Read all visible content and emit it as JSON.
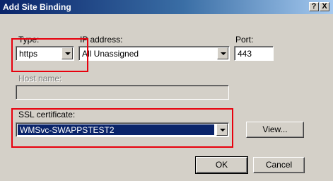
{
  "window": {
    "title": "Add Site Binding",
    "help_label": "?",
    "close_label": "X"
  },
  "type": {
    "label": "Type:",
    "value": "https"
  },
  "ip_address": {
    "label": "IP address:",
    "value": "All Unassigned"
  },
  "port": {
    "label": "Port:",
    "value": "443"
  },
  "host_name": {
    "label": "Host name:",
    "value": ""
  },
  "ssl_certificate": {
    "label": "SSL certificate:",
    "value": "WMSvc-SWAPPSTEST2"
  },
  "buttons": {
    "view": "View...",
    "ok": "OK",
    "cancel": "Cancel"
  },
  "colors": {
    "title_bar": "#0a246a",
    "dialog_bg": "#d4d0c8",
    "selection": "#0a246a",
    "highlight_box": "#e8000d"
  }
}
